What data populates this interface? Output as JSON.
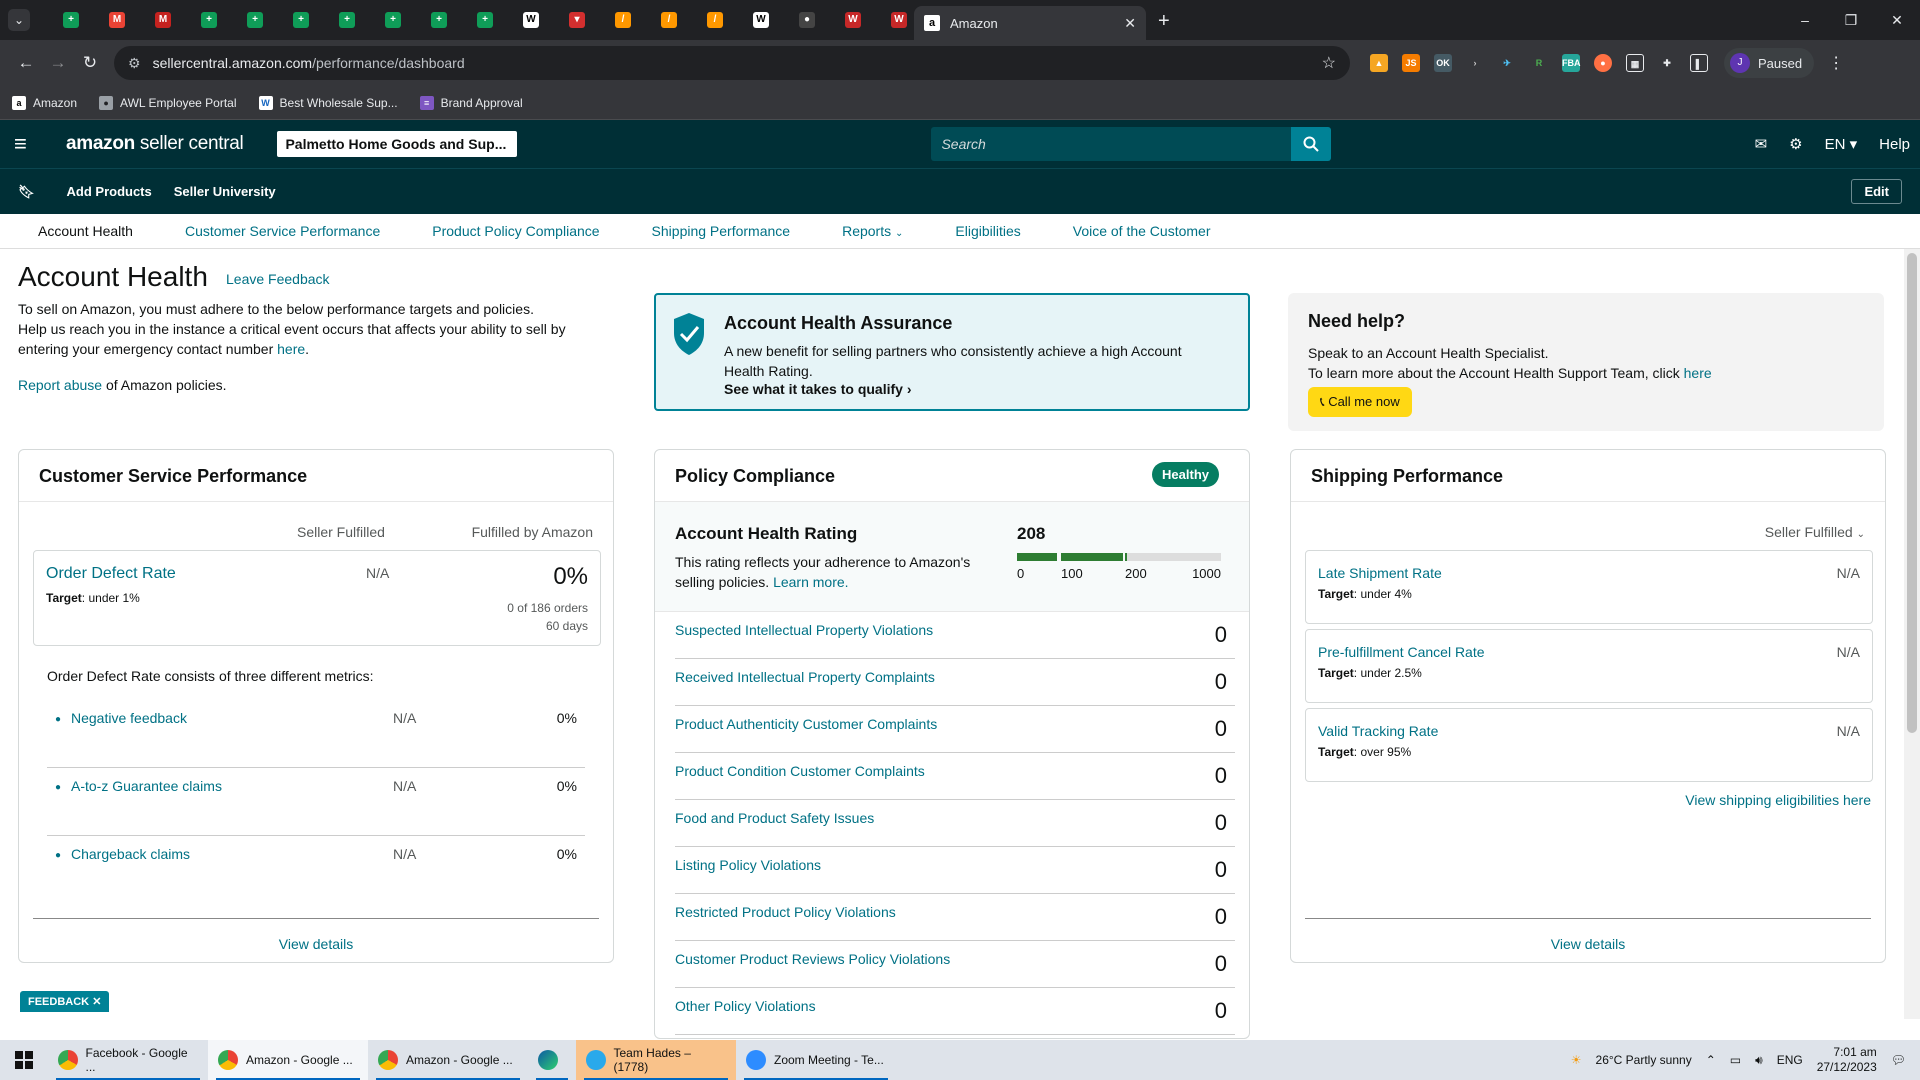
{
  "browser": {
    "active_tab": "Amazon",
    "pinned_tabs": [
      {
        "icon": "sheets-icon",
        "color": "#0f9d58",
        "g": "+"
      },
      {
        "icon": "gmail-icon",
        "color": "#ea4335",
        "g": "M"
      },
      {
        "icon": "gmail-icon",
        "color": "#c5221f",
        "g": "M"
      },
      {
        "icon": "sheets-icon",
        "color": "#0f9d58",
        "g": "+"
      },
      {
        "icon": "sheets-icon",
        "color": "#0f9d58",
        "g": "+"
      },
      {
        "icon": "sheets-icon",
        "color": "#0f9d58",
        "g": "+"
      },
      {
        "icon": "sheets-icon",
        "color": "#0f9d58",
        "g": "+"
      },
      {
        "icon": "sheets-icon",
        "color": "#0f9d58",
        "g": "+"
      },
      {
        "icon": "sheets-icon",
        "color": "#0f9d58",
        "g": "+"
      },
      {
        "icon": "sheets-icon",
        "color": "#0f9d58",
        "g": "+"
      },
      {
        "icon": "wholesale-icon",
        "color": "#ffffff",
        "g": "W"
      },
      {
        "icon": "store-icon",
        "color": "#d32f2f",
        "g": "▾"
      },
      {
        "icon": "tool-icon",
        "color": "#ff9800",
        "g": "/"
      },
      {
        "icon": "tool-icon",
        "color": "#ff9800",
        "g": "/"
      },
      {
        "icon": "tool-icon",
        "color": "#ff9800",
        "g": "/"
      },
      {
        "icon": "wholesale-icon",
        "color": "#ffffff",
        "g": "W"
      },
      {
        "icon": "avatar-icon",
        "color": "#444444",
        "g": "●"
      },
      {
        "icon": "w-icon",
        "color": "#c62828",
        "g": "W"
      },
      {
        "icon": "w-icon",
        "color": "#c62828",
        "g": "W"
      }
    ],
    "url_host": "sellercentral.amazon.com",
    "url_path": "/performance/dashboard",
    "profile_initial": "J",
    "profile_status": "Paused",
    "bookmarks": [
      {
        "label": "Amazon",
        "icon": "amazon-icon"
      },
      {
        "label": "AWL Employee Portal",
        "icon": "globe-icon"
      },
      {
        "label": "Best Wholesale Sup...",
        "icon": "wc-icon"
      },
      {
        "label": "Brand Approval",
        "icon": "list-icon"
      }
    ]
  },
  "header": {
    "logo_brand": "amazon",
    "logo_suffix": " seller central",
    "store_name": "Palmetto Home Goods and Sup...",
    "search_placeholder": "Search",
    "language": "EN",
    "help": "Help",
    "sub_links": [
      "Add Products",
      "Seller University"
    ],
    "edit": "Edit"
  },
  "page_tabs": [
    "Account Health",
    "Customer Service Performance",
    "Product Policy Compliance",
    "Shipping Performance",
    "Reports",
    "Eligibilities",
    "Voice of the Customer"
  ],
  "intro": {
    "title": "Account Health",
    "leave_feedback": "Leave Feedback",
    "line1": "To sell on Amazon, you must adhere to the below performance targets and policies.",
    "line2": "Help us reach you in the instance a critical event occurs that affects your ability to sell by entering your emergency contact number ",
    "here": "here",
    "line2_end": ".",
    "report_abuse": "Report abuse",
    "report_rest": " of Amazon policies."
  },
  "assurance": {
    "title": "Account Health Assurance",
    "text": "A new benefit for selling partners who consistently achieve a high Account Health Rating.",
    "cta": "See what it takes to qualify"
  },
  "need_help": {
    "title": "Need help?",
    "line1": "Speak to an Account Health Specialist.",
    "line2": "To learn more about the Account Health Support Team, click ",
    "here": "here",
    "call": "Call me now"
  },
  "customer_service": {
    "title": "Customer Service Performance",
    "col_seller": "Seller Fulfilled",
    "col_fba": "Fulfilled by Amazon",
    "odr_label": "Order Defect Rate",
    "odr_target_label": "Target",
    "odr_target": ": under 1%",
    "odr_seller": "N/A",
    "odr_fba": "0%",
    "odr_orders": "0 of 186 orders",
    "odr_days": "60 days",
    "consists": "Order Defect Rate consists of three different metrics:",
    "metrics": [
      {
        "name": "Negative feedback",
        "seller": "N/A",
        "fba": "0%"
      },
      {
        "name": "A-to-z Guarantee claims",
        "seller": "N/A",
        "fba": "0%"
      },
      {
        "name": "Chargeback claims",
        "seller": "N/A",
        "fba": "0%"
      }
    ],
    "view_details": "View details"
  },
  "policy": {
    "title": "Policy Compliance",
    "status": "Healthy",
    "ahr_title": "Account Health Rating",
    "ahr_text": "This rating reflects your adherence to Amazon's selling policies. ",
    "learn_more": "Learn more.",
    "score": "208",
    "score_value": 208,
    "scale": [
      "0",
      "100",
      "200",
      "1000"
    ],
    "rows": [
      {
        "name": "Suspected Intellectual Property Violations",
        "count": "0"
      },
      {
        "name": "Received Intellectual Property Complaints",
        "count": "0"
      },
      {
        "name": "Product Authenticity Customer Complaints",
        "count": "0"
      },
      {
        "name": "Product Condition Customer Complaints",
        "count": "0"
      },
      {
        "name": "Food and Product Safety Issues",
        "count": "0"
      },
      {
        "name": "Listing Policy Violations",
        "count": "0"
      },
      {
        "name": "Restricted Product Policy Violations",
        "count": "0"
      },
      {
        "name": "Customer Product Reviews Policy Violations",
        "count": "0"
      },
      {
        "name": "Other Policy Violations",
        "count": "0"
      }
    ]
  },
  "shipping": {
    "title": "Shipping Performance",
    "filter": "Seller Fulfilled",
    "metrics": [
      {
        "name": "Late Shipment Rate",
        "target": ": under 4%",
        "value": "N/A"
      },
      {
        "name": "Pre-fulfillment Cancel Rate",
        "target": ": under 2.5%",
        "value": "N/A"
      },
      {
        "name": "Valid Tracking Rate",
        "target": ": over 95%",
        "value": "N/A"
      }
    ],
    "target_label": "Target",
    "eligibilities": "View shipping eligibilities here",
    "view_details": "View details"
  },
  "feedback_tab": "FEEDBACK",
  "taskbar": {
    "apps": [
      {
        "label": "Facebook - Google ...",
        "icon": "chrome-icon",
        "active": false
      },
      {
        "label": "Amazon - Google ...",
        "icon": "chrome-icon",
        "active": true
      },
      {
        "label": "Amazon - Google ...",
        "icon": "chrome-icon",
        "active": false
      },
      {
        "label": "",
        "icon": "edge-icon",
        "active": false
      },
      {
        "label": "Team Hades – (1778)",
        "icon": "telegram-icon",
        "active": false
      },
      {
        "label": "Zoom Meeting - Te...",
        "icon": "zoom-icon",
        "active": false
      }
    ],
    "weather": "26°C  Partly sunny",
    "lang": "ENG",
    "time": "7:01 am",
    "date": "27/12/2023"
  }
}
